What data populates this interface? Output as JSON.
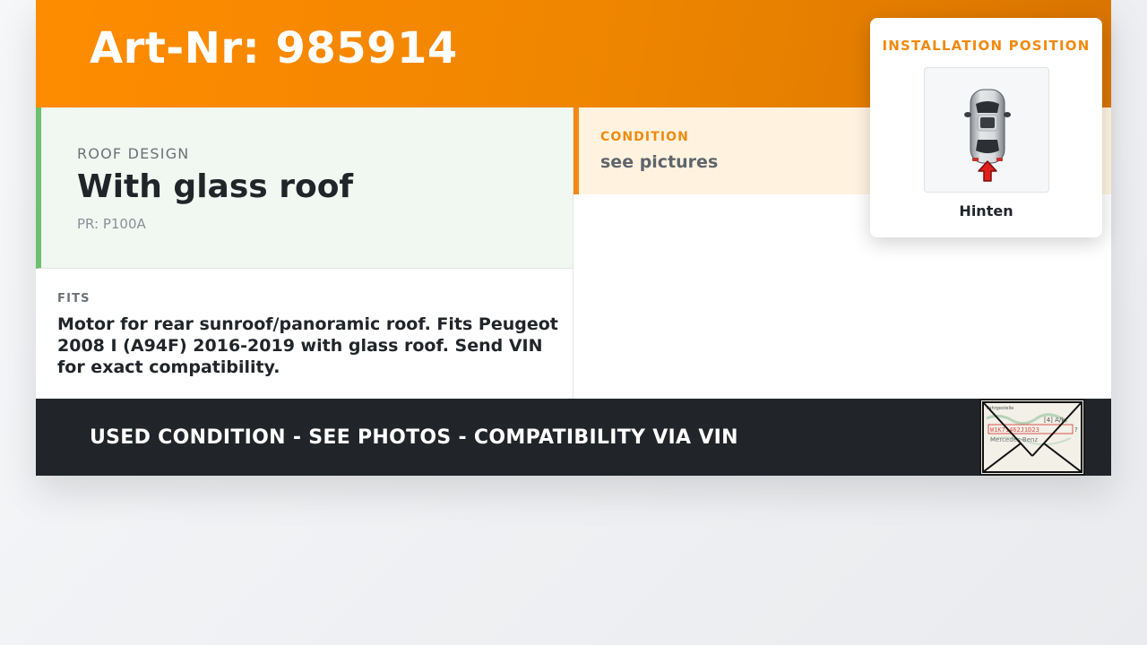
{
  "header": {
    "art_nr": "Art-Nr: 985914"
  },
  "roof_design": {
    "label": "ROOF DESIGN",
    "value": "With glass roof",
    "pr_code": "PR: P100A"
  },
  "fits": {
    "label": "FITS",
    "text": "Motor for rear sunroof/panoramic roof. Fits Peugeot 2008 I (A94F) 2016-2019 with glass roof. Send VIN for exact compatibility."
  },
  "condition": {
    "label": "CONDITION",
    "value": "see pictures"
  },
  "installation": {
    "title": "INSTALLATION POSITION",
    "position": "Hinten",
    "icon": "car-top-view-rear-arrow-icon"
  },
  "footer": {
    "banner": "USED CONDITION - SEE PHOTOS - COMPATIBILITY VIA VIN",
    "thumbnail_icon": "vin-document-envelope-icon"
  },
  "colors": {
    "header_orange": "#ff8c00",
    "accent_orange": "#f08a10",
    "accent_green": "#6cc070",
    "footer_dark": "#212529",
    "arrow_red": "#e0201c"
  }
}
